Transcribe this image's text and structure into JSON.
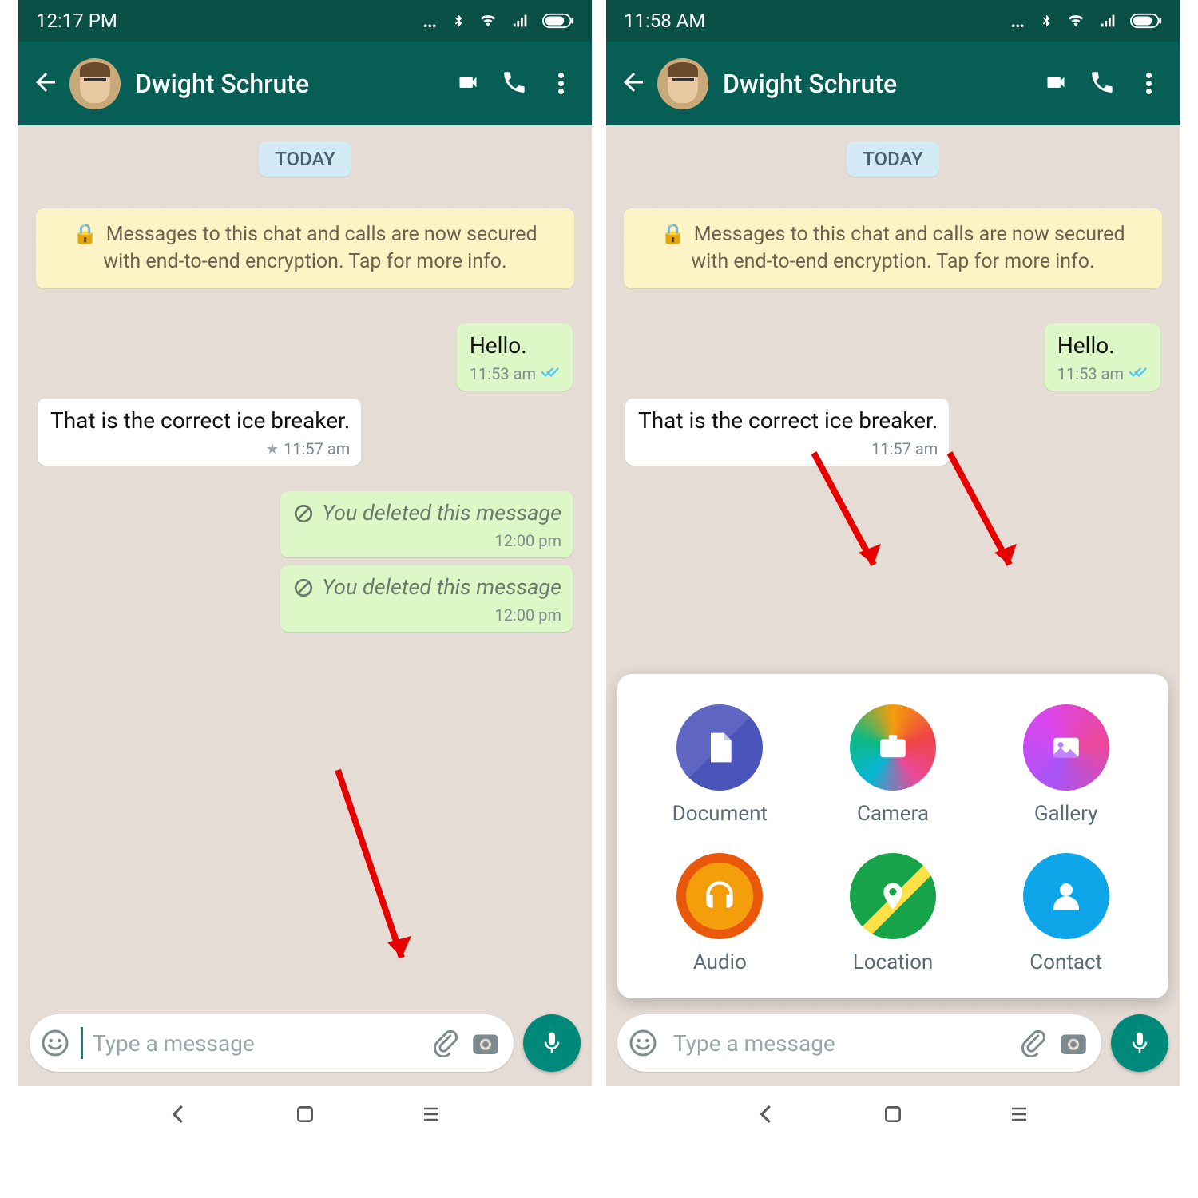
{
  "panel_left": {
    "status_time": "12:17 PM",
    "contact_name": "Dwight Schrute",
    "date_chip": "TODAY",
    "encryption_text": "Messages to this chat and calls are now secured with end-to-end encryption. Tap for more info.",
    "messages": {
      "m1_text": "Hello.",
      "m1_time": "11:53 am",
      "m2_text": "That is the correct ice breaker.",
      "m2_time": "11:57 am",
      "m3_text": "You deleted this message",
      "m3_time": "12:00 pm",
      "m4_text": "You deleted this message",
      "m4_time": "12:00 pm"
    },
    "input_placeholder": "Type a message"
  },
  "panel_right": {
    "status_time": "11:58 AM",
    "contact_name": "Dwight Schrute",
    "date_chip": "TODAY",
    "encryption_text": "Messages to this chat and calls are now secured with end-to-end encryption. Tap for more info.",
    "messages": {
      "m1_text": "Hello.",
      "m1_time": "11:53 am",
      "m2_text": "That is the correct ice breaker.",
      "m2_time": "11:57 am"
    },
    "input_placeholder": "Type a message",
    "attach": {
      "document": "Document",
      "camera": "Camera",
      "gallery": "Gallery",
      "audio": "Audio",
      "location": "Location",
      "contact": "Contact"
    }
  }
}
